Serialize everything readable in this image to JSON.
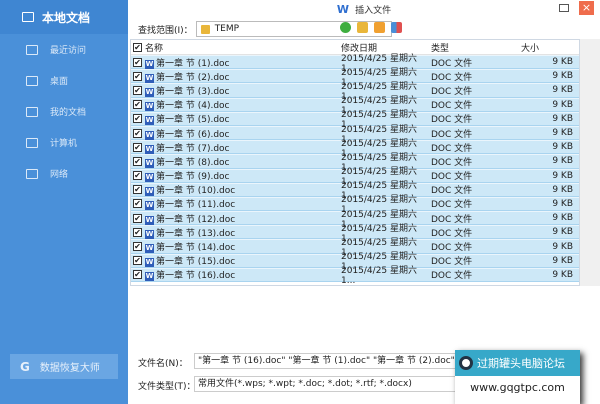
{
  "sidebar": {
    "title": "本地文档",
    "items": [
      {
        "label": "最近访问",
        "icon": "recent-icon"
      },
      {
        "label": "桌面",
        "icon": "desktop-icon"
      },
      {
        "label": "我的文档",
        "icon": "folder-icon"
      },
      {
        "label": "计算机",
        "icon": "computer-icon"
      },
      {
        "label": "网络",
        "icon": "network-icon"
      }
    ],
    "recover": "数据恢复大师"
  },
  "dialog": {
    "title": "插入文件",
    "look_in_label": "查找范围(I)：",
    "look_in_value": "TEMP"
  },
  "columns": {
    "name": "名称",
    "date": "修改日期",
    "type": "类型",
    "size": "大小"
  },
  "files": [
    {
      "name": "第一章 节 (1).doc",
      "date": "2015/4/25 星期六 1...",
      "type": "DOC 文件",
      "size": "9 KB"
    },
    {
      "name": "第一章 节 (2).doc",
      "date": "2015/4/25 星期六 1...",
      "type": "DOC 文件",
      "size": "9 KB"
    },
    {
      "name": "第一章 节 (3).doc",
      "date": "2015/4/25 星期六 1...",
      "type": "DOC 文件",
      "size": "9 KB"
    },
    {
      "name": "第一章 节 (4).doc",
      "date": "2015/4/25 星期六 1...",
      "type": "DOC 文件",
      "size": "9 KB"
    },
    {
      "name": "第一章 节 (5).doc",
      "date": "2015/4/25 星期六 1...",
      "type": "DOC 文件",
      "size": "9 KB"
    },
    {
      "name": "第一章 节 (6).doc",
      "date": "2015/4/25 星期六 1...",
      "type": "DOC 文件",
      "size": "9 KB"
    },
    {
      "name": "第一章 节 (7).doc",
      "date": "2015/4/25 星期六 1...",
      "type": "DOC 文件",
      "size": "9 KB"
    },
    {
      "name": "第一章 节 (8).doc",
      "date": "2015/4/25 星期六 1...",
      "type": "DOC 文件",
      "size": "9 KB"
    },
    {
      "name": "第一章 节 (9).doc",
      "date": "2015/4/25 星期六 1...",
      "type": "DOC 文件",
      "size": "9 KB"
    },
    {
      "name": "第一章 节 (10).doc",
      "date": "2015/4/25 星期六 1...",
      "type": "DOC 文件",
      "size": "9 KB"
    },
    {
      "name": "第一章 节 (11).doc",
      "date": "2015/4/25 星期六 1...",
      "type": "DOC 文件",
      "size": "9 KB"
    },
    {
      "name": "第一章 节 (12).doc",
      "date": "2015/4/25 星期六 1...",
      "type": "DOC 文件",
      "size": "9 KB"
    },
    {
      "name": "第一章 节 (13).doc",
      "date": "2015/4/25 星期六 1...",
      "type": "DOC 文件",
      "size": "9 KB"
    },
    {
      "name": "第一章 节 (14).doc",
      "date": "2015/4/25 星期六 1...",
      "type": "DOC 文件",
      "size": "9 KB"
    },
    {
      "name": "第一章 节 (15).doc",
      "date": "2015/4/25 星期六 1...",
      "type": "DOC 文件",
      "size": "9 KB"
    },
    {
      "name": "第一章 节 (16).doc",
      "date": "2015/4/25 星期六 1...",
      "type": "DOC 文件",
      "size": "9 KB"
    }
  ],
  "footer": {
    "filename_label": "文件名(N)：",
    "filename_value": "\"第一章 节 (16).doc\" \"第一章 节 (1).doc\" \"第一章 节 (2).doc\" \"第",
    "filetype_label": "文件类型(T)：",
    "filetype_value": "常用文件(*.wps; *.wpt; *.doc; *.dot; *.rtf; *.docx)"
  },
  "watermark": {
    "title": "过期罐头电脑论坛",
    "url": "www.gqgtpc.com"
  },
  "colors": {
    "sidebar": "#4a90d9",
    "selected_row": "#cde8f7",
    "close": "#ef6c4c"
  }
}
